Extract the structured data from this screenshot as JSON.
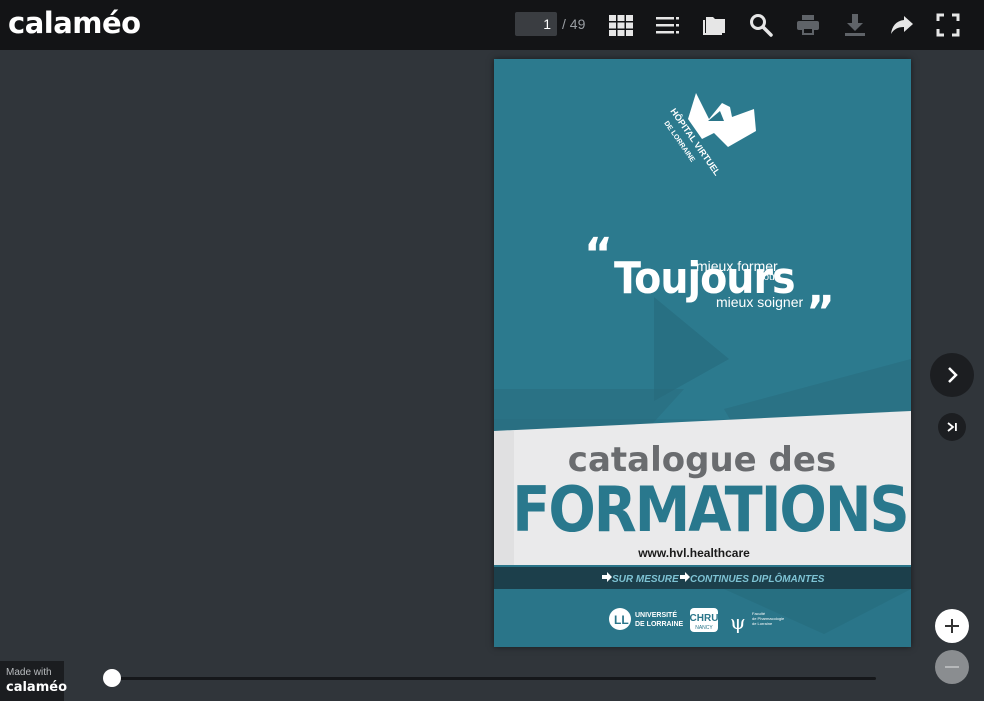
{
  "app": {
    "logo": "calaméo"
  },
  "toolbar": {
    "current_page": "1",
    "total_pages": "/ 49",
    "icons": [
      "grid-icon",
      "list-icon",
      "folder-icon",
      "search-icon",
      "print-icon",
      "download-icon",
      "share-icon",
      "fullscreen-icon"
    ]
  },
  "cover": {
    "logo_text_line1": "HÔPITAL VIRTUEL",
    "logo_text_line2": "DE LORRAINE",
    "quote_main": "Toujours",
    "quote_top": "mieux former",
    "quote_mid": "pour",
    "quote_bottom": "mieux soigner",
    "title_line1": "catalogue des",
    "title_line2": "FORMATIONS",
    "website": "www.hvl.healthcare",
    "strip_item1": "SUR MESURE",
    "strip_item2": "CONTINUES DIPLÔMANTES",
    "partner1_line1": "UNIVERSITÉ",
    "partner1_line2": "DE LORRAINE",
    "partner2": "CHRU",
    "partner2_sub": "NANCY",
    "partner3_line1": "Faculté",
    "partner3_line2": "de Pharmacologie",
    "partner3_line3": "de Lorraine"
  },
  "footer": {
    "made_with": "Made with",
    "brand": "calaméo"
  },
  "slider": {
    "progress": 0.0
  },
  "colors": {
    "page_teal": "#2a7589",
    "accent_teal": "#29788d",
    "title_gray": "#6a6c6f"
  }
}
